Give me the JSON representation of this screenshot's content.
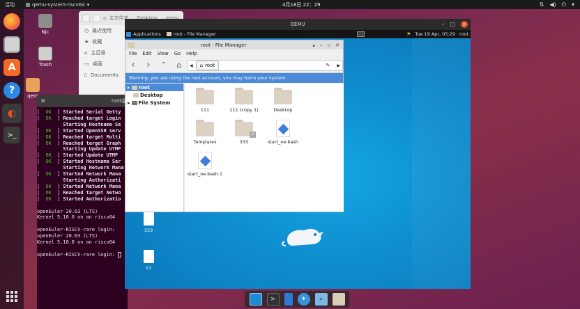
{
  "topbar": {
    "activities": "活动",
    "app_name": "qemu-system-riscv64",
    "clock": "4月18日 22：29",
    "sys_icons": [
      "network-icon",
      "volume-icon",
      "power-icon",
      "menu-icon"
    ]
  },
  "dock": {
    "items": [
      "firefox-icon",
      "files-icon",
      "software-icon",
      "help-icon",
      "app-icon",
      "terminal-icon"
    ],
    "show_apps": "apps-grid-icon"
  },
  "desktop": {
    "icons": [
      {
        "name": "Njc",
        "label": "Njc"
      },
      {
        "name": "trash",
        "label": "Trash"
      },
      {
        "name": "qem",
        "label": "qem"
      }
    ]
  },
  "files_window": {
    "tab_home": "主文件夹",
    "tab_desktop": "Desktop",
    "tab_qemu": "qemu",
    "sidebar": [
      "最近使用",
      "收藏",
      "主目录",
      "桌面",
      "Documents"
    ]
  },
  "terminal": {
    "title": "root@",
    "lines": [
      {
        "ok": true,
        "text": "Started Serial Getty"
      },
      {
        "ok": true,
        "text": "Reached target Login"
      },
      {
        "ok": false,
        "text": "Starting Hostname Se"
      },
      {
        "ok": true,
        "text": "Started OpenSSH serv"
      },
      {
        "ok": true,
        "text": "Reached target Multi"
      },
      {
        "ok": true,
        "text": "Reached target Graph"
      },
      {
        "ok": false,
        "text": "Starting Update UTMP"
      },
      {
        "ok": true,
        "text": "Started Update UTMP"
      },
      {
        "ok": true,
        "text": "Started Hostname Ser"
      },
      {
        "ok": false,
        "text": "Starting Network Mana"
      },
      {
        "ok": true,
        "text": "Started Network Mana"
      },
      {
        "ok": false,
        "text": "Starting Authorizati"
      },
      {
        "ok": true,
        "text": "Started Network Mana"
      },
      {
        "ok": true,
        "text": "Reached target Netwo"
      },
      {
        "ok": true,
        "text": "Started Authorizatio"
      }
    ],
    "tail": [
      "",
      "openEuler 20.03 (LTS)",
      "Kernel 5.10.0 on an riscv64",
      "",
      "openEuler-RISCV-rare login:",
      "openEuler 20.03 (LTS)",
      "Kernel 5.10.0 on an riscv64",
      "",
      "openEuler-RISCV-rare login: "
    ]
  },
  "qemu": {
    "title": "QEMU",
    "panel": {
      "applications": "Applications",
      "task": "root - File Manager",
      "clock": "Tue 19 Apr, 05:29",
      "user": "root"
    },
    "desktop_icons": [
      {
        "label": "333"
      },
      {
        "label": "11"
      }
    ]
  },
  "file_manager": {
    "title": "root - File Manager",
    "menu": [
      "File",
      "Edit",
      "View",
      "Go",
      "Help"
    ],
    "path": "root",
    "warning": "Warning, you are using the root account, you may harm your system.",
    "tree": [
      {
        "label": "root",
        "selected": true
      },
      {
        "label": "Desktop",
        "selected": false
      },
      {
        "label": "File System",
        "selected": false
      }
    ],
    "items": [
      {
        "label": "111",
        "kind": "folder"
      },
      {
        "label": "111 (copy 1)",
        "kind": "folder"
      },
      {
        "label": "Desktop",
        "kind": "folder-desktop"
      },
      {
        "label": "Templates",
        "kind": "folder"
      },
      {
        "label": "333",
        "kind": "folder-link"
      },
      {
        "label": "start_oe.bash",
        "kind": "script"
      },
      {
        "label": "start_oe.bash.1",
        "kind": "script"
      }
    ]
  }
}
